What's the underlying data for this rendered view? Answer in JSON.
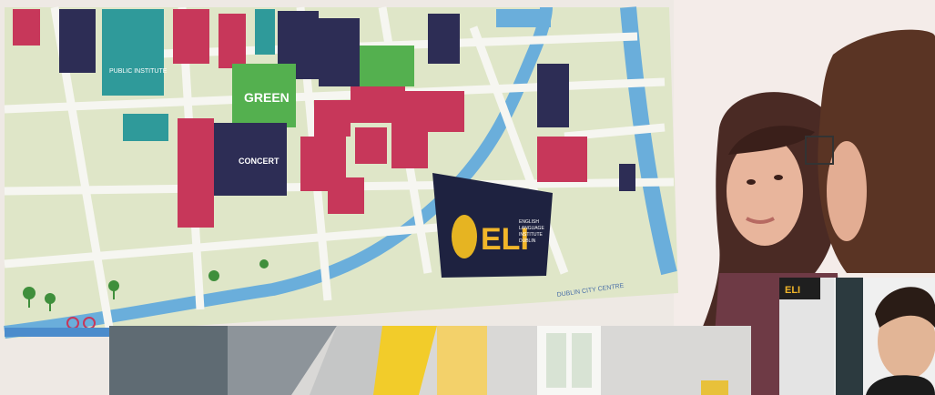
{
  "map_mural": {
    "logo": {
      "letters": "ELI",
      "lines": [
        "ENGLISH",
        "LANGUAGE",
        "INSTITUTE",
        "DUBLIN"
      ]
    },
    "labels": {
      "public_institute": "PUBLIC INSTITUTE",
      "green": "GREEN",
      "concert": "CONCERT",
      "caption": "DUBLIN CITY CENTRE",
      "small_logo": "ELI"
    }
  }
}
